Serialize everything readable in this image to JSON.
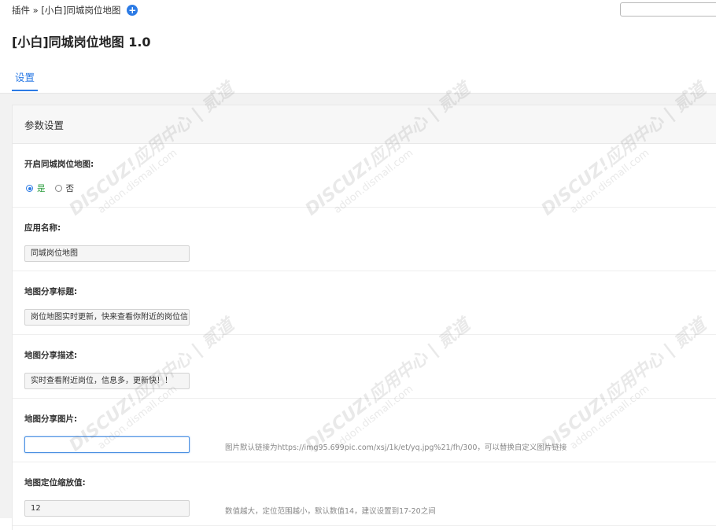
{
  "header": {
    "breadcrumb": "插件 » [小白]同城岗位地图",
    "plus_icon": "+",
    "search_value": ""
  },
  "page_title": "[小白]同城岗位地图 1.0",
  "tabs": [
    {
      "label": "设置",
      "active": true
    }
  ],
  "panel": {
    "title": "参数设置",
    "fields": {
      "enable": {
        "label": "开启同城岗位地图:",
        "options": [
          "是",
          "否"
        ],
        "selected": "是"
      },
      "app_name": {
        "label": "应用名称:",
        "value": "同城岗位地图"
      },
      "share_title": {
        "label": "地图分享标题:",
        "value": "岗位地图实时更新，快来查看你附近的岗位信"
      },
      "share_desc": {
        "label": "地图分享描述:",
        "value": "实时查看附近岗位，信息多，更新快！！"
      },
      "share_image": {
        "label": "地图分享图片:",
        "value": "",
        "hint": "图片默认链接为https://img95.699pic.com/xsj/1k/et/yq.jpg%21/fh/300，可以替换自定义图片链接"
      },
      "zoom": {
        "label": "地图定位缩放值:",
        "value": "12",
        "hint": "数值越大，定位范围越小，默认数值14，建议设置到17-20之间"
      }
    }
  },
  "watermark": {
    "line1": "DISCUZ!应用中心 | 贰道",
    "line2": "addon.dismall.com"
  },
  "colors": {
    "accent": "#2c7be5",
    "radio_on_label": "#2a9d3c",
    "band_bg": "#f2f2f2"
  }
}
